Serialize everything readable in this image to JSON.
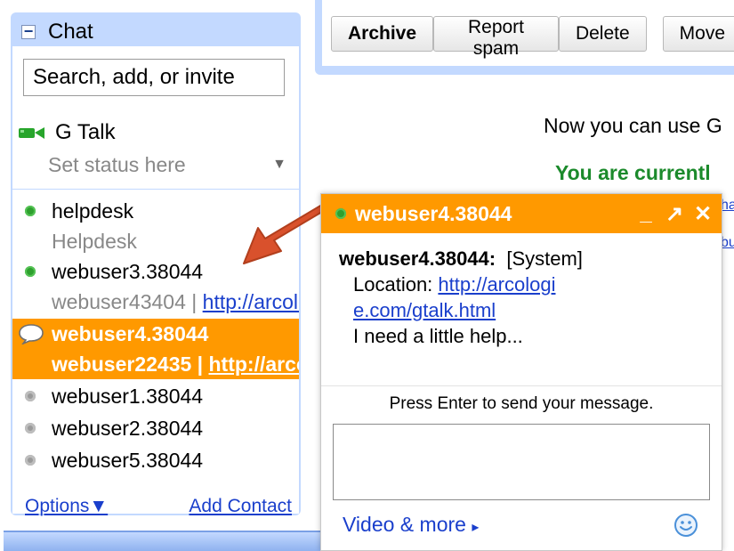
{
  "chat_panel": {
    "collapse_symbol": "−",
    "title": "Chat",
    "search_placeholder": "Search, add, or invite",
    "gtalk_label": "G Talk",
    "status_placeholder": "Set status here",
    "status_caret": "▼",
    "contacts": [
      {
        "name": "helpdesk",
        "sub": "Helpdesk",
        "status": "online"
      },
      {
        "name": "webuser3.38044",
        "sub_text": "webuser43404 | ",
        "sub_link": "http://arcologie.com",
        "status": "online"
      },
      {
        "name": "webuser4.38044",
        "sub_text": "webuser22435 | ",
        "sub_link": "http://arcologie.com",
        "status": "chatting",
        "selected": true
      },
      {
        "name": "webuser1.38044",
        "status": "offline"
      },
      {
        "name": "webuser2.38044",
        "status": "offline"
      },
      {
        "name": "webuser5.38044",
        "status": "offline"
      }
    ],
    "options_label": "Options▼",
    "add_contact_label": "Add Contact"
  },
  "toolbar": {
    "archive": "Archive",
    "report_spam": "Report spam",
    "delete": "Delete",
    "move": "Move"
  },
  "message": {
    "line1": "Now you can use G",
    "line2": "You are currentl",
    "partial_1": "ha",
    "partial_2": "bu"
  },
  "chat_window": {
    "title": "webuser4.38044",
    "minimize": "_",
    "popout": "↗",
    "close": "✕",
    "sender": "webuser4.38044:",
    "system_tag": "[System]",
    "location_label": "Location: ",
    "location_link_1": "http://arcologi",
    "location_link_2": "e.com/gtalk.html",
    "body": "I need a little help...",
    "hint": "Press Enter to send your message.",
    "video_more": "Video & more",
    "video_more_arrow": "▸"
  },
  "colors": {
    "accent_orange": "#ff9900",
    "panel_blue": "#c3d9ff",
    "link_blue": "#1a3fcc",
    "arrow_red": "#d9512c",
    "online_green": "#2ea02e"
  }
}
